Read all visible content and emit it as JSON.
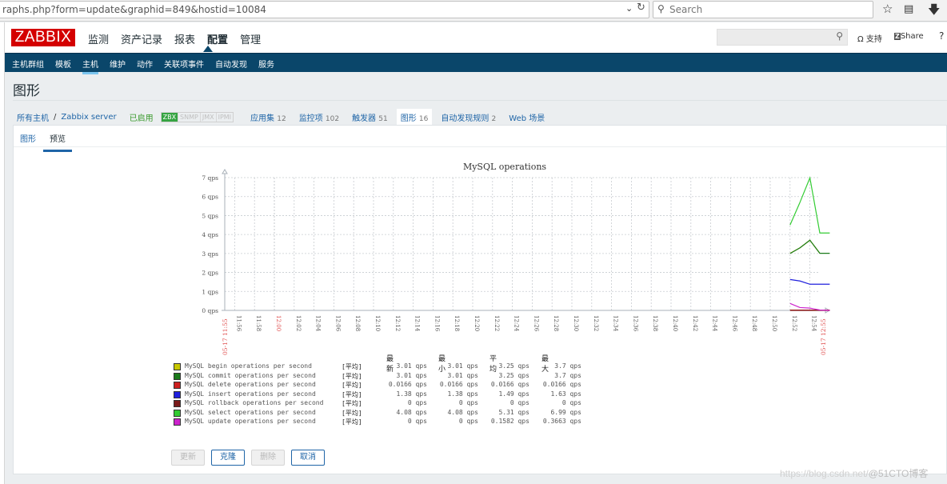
{
  "browser": {
    "url": "raphs.php?form=update&graphid=849&hostid=10084",
    "search_placeholder": "Search"
  },
  "header": {
    "logo": "ZABBIX",
    "menu": [
      "监测",
      "资产记录",
      "报表",
      "配置",
      "管理"
    ],
    "active_menu": "配置",
    "support": "支持",
    "share": "Share",
    "help": "?"
  },
  "subnav": {
    "items": [
      "主机群组",
      "模板",
      "主机",
      "维护",
      "动作",
      "关联项事件",
      "自动发现",
      "服务"
    ],
    "active": "主机"
  },
  "page": {
    "title": "图形",
    "breadcrumb": [
      "所有主机",
      "Zabbix server"
    ],
    "status": "已启用",
    "availability": [
      "ZBX",
      "SNMP",
      "JMX",
      "IPMI"
    ],
    "host_tabs": [
      {
        "label": "应用集",
        "count": "12"
      },
      {
        "label": "监控项",
        "count": "102"
      },
      {
        "label": "触发器",
        "count": "51"
      },
      {
        "label": "图形",
        "count": "16"
      },
      {
        "label": "自动发现规则",
        "count": "2"
      },
      {
        "label": "Web 场景",
        "count": ""
      }
    ],
    "form_tabs": [
      "图形",
      "预览"
    ],
    "buttons": {
      "update": "更新",
      "clone": "克隆",
      "delete": "删除",
      "cancel": "取消"
    }
  },
  "chart_data": {
    "type": "line",
    "title": "MySQL operations",
    "ylabel": "qps",
    "ylim": [
      0,
      7
    ],
    "y_ticks": [
      "0 qps",
      "1 qps",
      "2 qps",
      "3 qps",
      "4 qps",
      "5 qps",
      "6 qps",
      "7 qps"
    ],
    "x_ticks": [
      "11:56",
      "11:58",
      "12:00",
      "12:02",
      "12:04",
      "12:06",
      "12:08",
      "12:10",
      "12:12",
      "12:14",
      "12:16",
      "12:18",
      "12:20",
      "12:22",
      "12:24",
      "12:26",
      "12:28",
      "12:30",
      "12:32",
      "12:34",
      "12:36",
      "12:38",
      "12:40",
      "12:42",
      "12:44",
      "12:46",
      "12:48",
      "12:50",
      "12:52",
      "12:54"
    ],
    "x_start_label": "05-17 11:55",
    "x_end_label": "05-17 12:55",
    "x_range_minutes": [
      0,
      60
    ],
    "legend_headers": [
      "最新",
      "最小",
      "平均",
      "最大"
    ],
    "series": [
      {
        "name": "MySQL begin operations per second",
        "color": "#c8c800",
        "func": "[平均]",
        "last": "3.01 qps",
        "min": "3.01 qps",
        "avg": "3.25 qps",
        "max": "3.7 qps",
        "x": [
          57,
          58,
          59,
          60
        ],
        "values": [
          3.01,
          3.3,
          3.7,
          3.01
        ]
      },
      {
        "name": "MySQL commit operations per second",
        "color": "#1a7a1a",
        "func": "[平均]",
        "last": "3.01 qps",
        "min": "3.01 qps",
        "avg": "3.25 qps",
        "max": "3.7 qps",
        "x": [
          57,
          58,
          59,
          60,
          61
        ],
        "values": [
          3.0,
          3.3,
          3.7,
          3.01,
          3.01
        ]
      },
      {
        "name": "MySQL delete operations per second",
        "color": "#cc2020",
        "func": "[平均]",
        "last": "0.0166 qps",
        "min": "0.0166 qps",
        "avg": "0.0166 qps",
        "max": "0.0166 qps",
        "x": [
          57,
          61
        ],
        "values": [
          0.0166,
          0.0166
        ]
      },
      {
        "name": "MySQL insert operations per second",
        "color": "#2020dd",
        "func": "[平均]",
        "last": "1.38 qps",
        "min": "1.38 qps",
        "avg": "1.49 qps",
        "max": "1.63 qps",
        "x": [
          57,
          58,
          59,
          60,
          61
        ],
        "values": [
          1.63,
          1.55,
          1.38,
          1.38,
          1.38
        ]
      },
      {
        "name": "MySQL rollback operations per second",
        "color": "#7a1a1a",
        "func": "[平均]",
        "last": "0 qps",
        "min": "0 qps",
        "avg": "0 qps",
        "max": "0 qps",
        "x": [
          57,
          61
        ],
        "values": [
          0,
          0
        ]
      },
      {
        "name": "MySQL select operations per second",
        "color": "#33cc33",
        "func": "[平均]",
        "last": "4.08 qps",
        "min": "4.08 qps",
        "avg": "5.31 qps",
        "max": "6.99 qps",
        "x": [
          57,
          58,
          59,
          60,
          61
        ],
        "values": [
          4.5,
          5.7,
          6.99,
          4.08,
          4.08
        ]
      },
      {
        "name": "MySQL update operations per second",
        "color": "#cc22cc",
        "func": "[平均]",
        "last": "0 qps",
        "min": "0 qps",
        "avg": "0.1582 qps",
        "max": "0.3663 qps",
        "x": [
          57,
          58,
          59,
          60,
          61
        ],
        "values": [
          0.3663,
          0.15,
          0.12,
          0.02,
          0
        ]
      }
    ],
    "grid": true
  },
  "watermark": {
    "url": "https://blog.csdn.net/",
    "brand": "@51CTO博客"
  }
}
